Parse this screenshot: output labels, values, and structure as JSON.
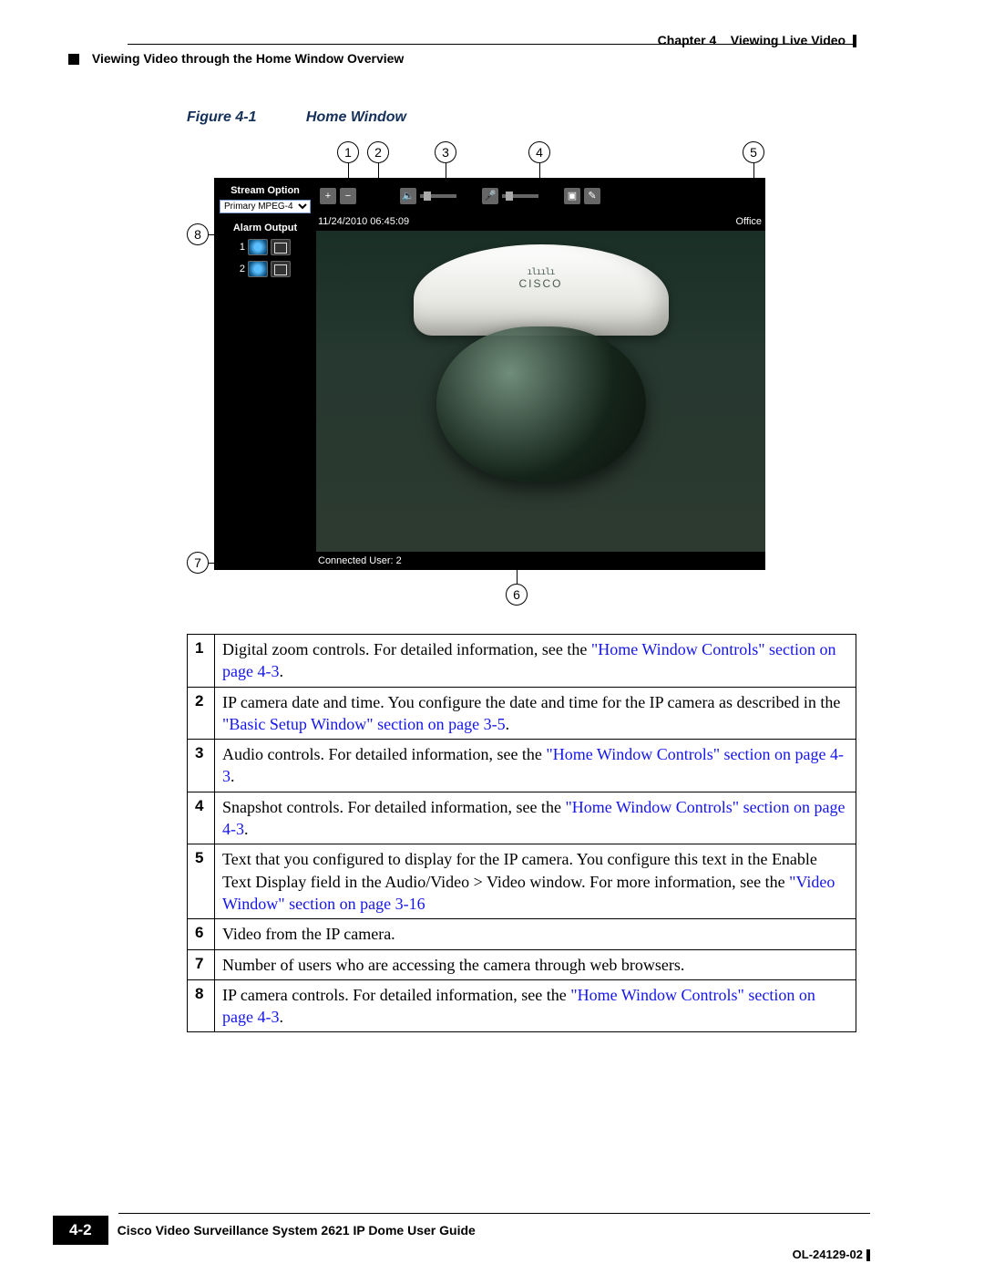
{
  "header": {
    "chapter_label": "Chapter 4",
    "chapter_title": "Viewing Live Video",
    "section_title": "Viewing Video through the Home Window Overview"
  },
  "figure": {
    "label": "Figure 4-1",
    "title": "Home Window",
    "callouts": [
      "1",
      "2",
      "3",
      "4",
      "5",
      "6",
      "7",
      "8"
    ],
    "camera_ui": {
      "stream_option_label": "Stream Option",
      "stream_option_value": "Primary MPEG-4",
      "alarm_output_label": "Alarm Output",
      "alarm_rows": [
        "1",
        "2"
      ],
      "timestamp": "11/24/2010 06:45:09",
      "location_label": "Office",
      "connected_user": "Connected User: 2",
      "logo_text": "CISCO",
      "logo_bars": "ılıılı"
    }
  },
  "table": {
    "rows": [
      {
        "num": "1",
        "text_pre": "Digital zoom controls. For detailed information, see the ",
        "link": "\"Home Window Controls\" section on page 4-3",
        "text_post": "."
      },
      {
        "num": "2",
        "text_pre": "IP camera date and time. You configure the date and time for the IP camera as described in the ",
        "link": "\"Basic Setup Window\" section on page 3-5",
        "text_post": "."
      },
      {
        "num": "3",
        "text_pre": "Audio controls. For detailed information, see the ",
        "link": "\"Home Window Controls\" section on page 4-3",
        "text_post": "."
      },
      {
        "num": "4",
        "text_pre": "Snapshot controls. For detailed information, see the ",
        "link": "\"Home Window Controls\" section on page 4-3",
        "text_post": "."
      },
      {
        "num": "5",
        "text_pre": "Text that you configured to display for the IP camera. You configure this text in the Enable Text Display field in the Audio/Video > Video window. For more information, see the ",
        "link": "\"Video Window\" section on page 3-16",
        "text_post": ""
      },
      {
        "num": "6",
        "text_pre": "Video from the IP camera.",
        "link": "",
        "text_post": ""
      },
      {
        "num": "7",
        "text_pre": "Number of users who are accessing the camera through web browsers.",
        "link": "",
        "text_post": ""
      },
      {
        "num": "8",
        "text_pre": "IP camera controls. For detailed information, see the ",
        "link": "\"Home Window Controls\" section on page 4-3",
        "text_post": "."
      }
    ]
  },
  "footer": {
    "guide_title": "Cisco Video Surveillance System 2621 IP Dome User Guide",
    "page_number": "4-2",
    "doc_id": "OL-24129-02"
  }
}
